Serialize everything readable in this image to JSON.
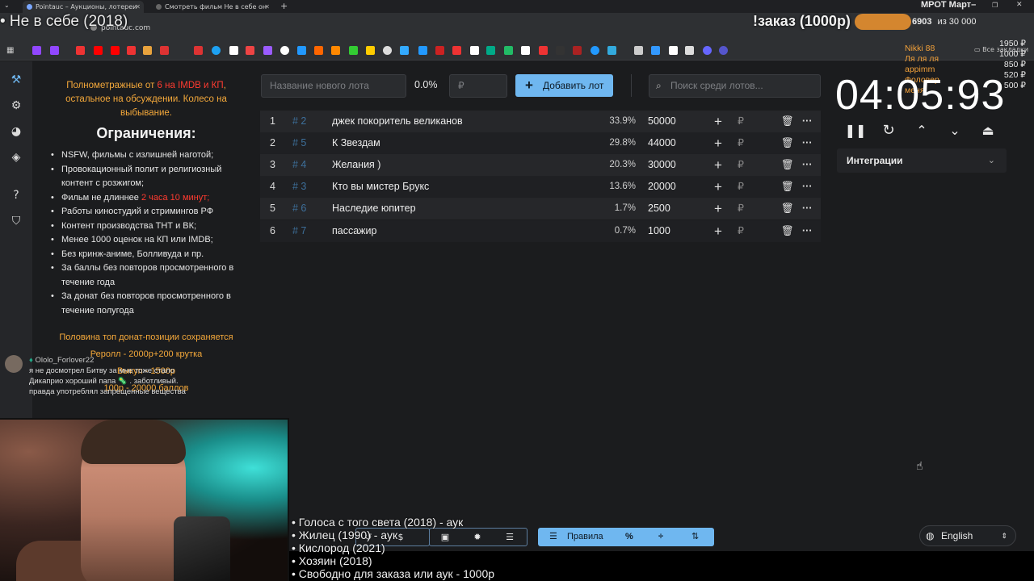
{
  "browser": {
    "tabs": [
      {
        "label": "Pointauc – Аукционы, лотереи",
        "active": true
      },
      {
        "label": "Смотреть фильм Не в себе он",
        "active": false
      }
    ],
    "new_tab": "+",
    "url": "pointauc.com",
    "bookmarks_all": "Все закладки"
  },
  "overlay": {
    "current_title": "• Не в себе (2018)",
    "order_label": "!заказ (1000р)",
    "goal_title": "МРОТ Март–",
    "goal_progress": "6903",
    "goal_total": "из 30 000",
    "donors": [
      {
        "name": "Nikki 88",
        "amount": "1950 ₽"
      },
      {
        "name": "Ля ля ля",
        "amount": "1000 ₽"
      },
      {
        "name": "appimm",
        "amount": "850 ₽"
      },
      {
        "name": "Фоловер",
        "amount": "520 ₽"
      },
      {
        "name": "меня",
        "amount": "500 ₽"
      }
    ]
  },
  "rules": {
    "intro_a": "Полнометражные от ",
    "intro_red": "6 на IMDB и КП",
    "intro_b": ", остальное на обсуждении. Колесо на выбывание.",
    "heading": "Ограничения:",
    "items": [
      "NSFW, фильмы с излишней наготой;",
      "Провокационный полит и религиозный контент с розжигом;",
      "Фильм не длиннее ",
      "Работы киностудий и стримингов РФ",
      "Контент производства ТНТ и ВК;",
      "Менее 1000 оценок на КП или IMDB;",
      "Без кринж-аниме, Болливуда и пр.",
      "За баллы без повторов просмотренного в течение года",
      "За донат без повторов просмотренного в течение полугода"
    ],
    "duration_red": "2 часа 10 минут;",
    "footer": [
      "Половина топ донат-позиции сохраняется",
      "Реролл - 2000р+200 крутка",
      "Выкуп - 1500р",
      "100р - 20000 баллов"
    ]
  },
  "chat": {
    "user": "Ololo_Forlover22",
    "lines": [
      "я не досмотрел Битву за мне тоже стало",
      "Дикаприо хороший папа 🦠 . заботливый.",
      "правда употреблял запрещенные вещества"
    ]
  },
  "lot_form": {
    "name_placeholder": "Название нового лота",
    "percent": "0.0%",
    "amount_placeholder": "₽",
    "add_label": "Добавить лот",
    "search_placeholder": "Поиск среди лотов..."
  },
  "lots": [
    {
      "index": "1",
      "id": "# 2",
      "name": "джек покоритель великанов",
      "percent": "33.9%",
      "amount": "50000"
    },
    {
      "index": "2",
      "id": "# 5",
      "name": "К Звездам",
      "percent": "29.8%",
      "amount": "44000"
    },
    {
      "index": "3",
      "id": "# 4",
      "name": "Желания )",
      "percent": "20.3%",
      "amount": "30000"
    },
    {
      "index": "4",
      "id": "# 3",
      "name": "Кто вы мистер Брукс",
      "percent": "13.6%",
      "amount": "20000"
    },
    {
      "index": "5",
      "id": "# 6",
      "name": "Наследие юпитер",
      "percent": "1.7%",
      "amount": "2500"
    },
    {
      "index": "6",
      "id": "# 7",
      "name": "пассажир",
      "percent": "0.7%",
      "amount": "1000"
    }
  ],
  "lot_icons": {
    "add": "+",
    "currency": "₽",
    "delete": "trash-icon",
    "more": "···"
  },
  "timer": {
    "value": "04:05:93"
  },
  "integrations": {
    "label": "Интеграции"
  },
  "toolbar": {
    "rules_label": "Правила",
    "percent": "%"
  },
  "language": {
    "label": "English"
  },
  "poll_list": [
    "• Голоса с того света (2018) - аук",
    "• Жилец (1990) - аук",
    "• Кислород (2021)",
    "• Хозяин (2018)",
    "• Свободно для заказа или аук - 1000р"
  ],
  "colors": {
    "accent": "#6fb7f0",
    "orange": "#f4a83a",
    "red": "#ff3b30",
    "background": "#1b1c1e"
  }
}
